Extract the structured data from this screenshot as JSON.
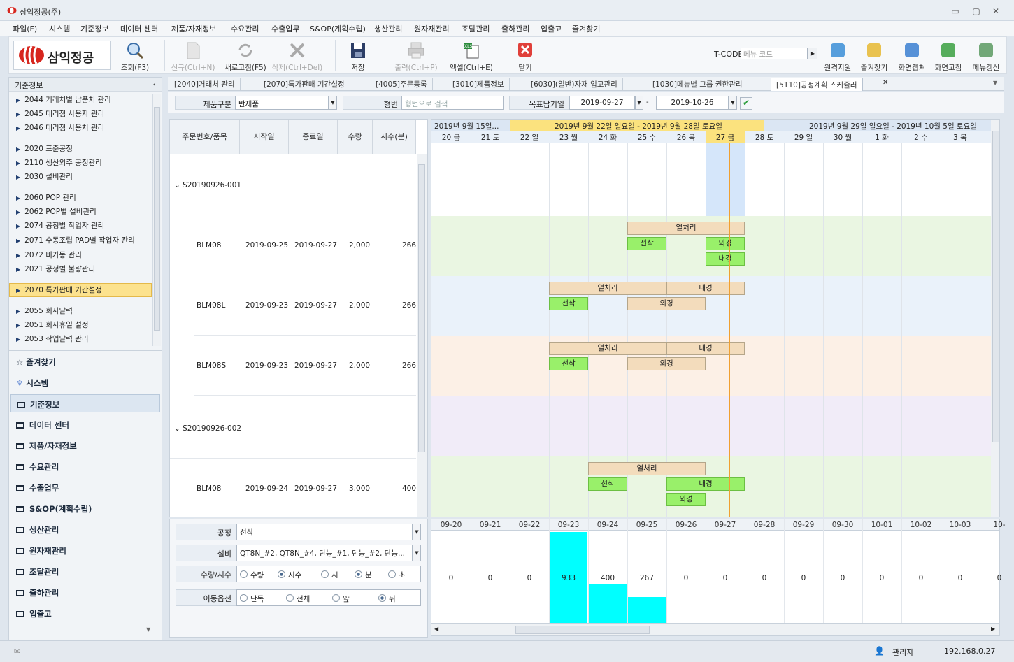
{
  "window": {
    "title": "삼익정공(주)"
  },
  "menu": [
    "파일(F)",
    "시스템",
    "기준정보",
    "데이터 센터",
    "제품/자재정보",
    "수요관리",
    "수출업무",
    "S&OP(계획수립)",
    "생산관리",
    "원자재관리",
    "조달관리",
    "출하관리",
    "입출고",
    "즐겨찾기"
  ],
  "toolbar": {
    "brand": "삼익정공",
    "buttons": [
      {
        "label": "조회(F3)",
        "icon": "search-icon",
        "enabled": true
      },
      {
        "label": "신규(Ctrl+N)",
        "icon": "new-doc-icon",
        "enabled": false
      },
      {
        "label": "새로고침(F5)",
        "icon": "refresh-icon",
        "enabled": true
      },
      {
        "label": "삭제(Ctrl+Del)",
        "icon": "delete-icon",
        "enabled": false
      },
      {
        "label": "저장",
        "icon": "save-icon",
        "enabled": true
      },
      {
        "label": "출력(Ctrl+P)",
        "icon": "print-icon",
        "enabled": false
      },
      {
        "label": "엑셀(Ctrl+E)",
        "icon": "excel-icon",
        "enabled": true
      },
      {
        "label": "닫기",
        "icon": "close-icon",
        "enabled": true
      }
    ],
    "tcode_label": "T-CODE",
    "tcode_placeholder": "메뉴 코드",
    "right_buttons": [
      "원격지원",
      "즐겨찾기",
      "화면캡쳐",
      "화면고침",
      "메뉴갱신"
    ]
  },
  "sidebar": {
    "header": "기준정보",
    "items": [
      "2044 거래처별 납품처 관리",
      "2045 대리점 사용자 관리",
      "2046 대리점 사용처 관리",
      "2020 표준공정",
      "2110 생산외주 공정관리",
      "2030 설비관리",
      "2060 POP 관리",
      "2062 POP별 설비관리",
      "2074 공정별 작업자 관리",
      "2071 수동조립 PAD별 작업자 관리",
      "2072 비가동 관리",
      "2021 공정별 불량관리",
      "2070 특가판매 기간설정",
      "2055 회사달력",
      "2051 회사휴일 설정",
      "2053 작업달력 관리"
    ],
    "selected": "2070 특가판매 기간설정",
    "favorites": "즐겨찾기",
    "system": "시스템",
    "groups": [
      "기준정보",
      "데이터 센터",
      "제품/자재정보",
      "수요관리",
      "수출업무",
      "S&OP(계획수립)",
      "생산관리",
      "원자재관리",
      "조달관리",
      "출하관리",
      "입출고"
    ]
  },
  "tabs": [
    "[2040]거래처 관리",
    "[2070]특가판매 기간설정",
    "[4005]주문등록",
    "[3010]제품정보",
    "[6030](일반)자재 입고관리",
    "[1030]메뉴별 그룹 권한관리",
    "[5110]공정계획 스케쥴러"
  ],
  "filter": {
    "product_type_label": "제품구분",
    "product_type_value": "반제품",
    "model_label": "형번",
    "model_placeholder": "형번으로 검색",
    "target_label": "목표납기일",
    "date_from": "2019-09-27",
    "date_sep": "-",
    "date_to": "2019-10-26"
  },
  "grid": {
    "headers": [
      "주문번호/품목",
      "시작일",
      "종료일",
      "수량",
      "시수(분)"
    ],
    "groups": [
      {
        "order": "S20190926-001",
        "rows": [
          {
            "item": "BLM08",
            "start": "2019-09-25",
            "end": "2019-09-27",
            "qty": "2,000",
            "min": "266"
          },
          {
            "item": "BLM08L",
            "start": "2019-09-23",
            "end": "2019-09-27",
            "qty": "2,000",
            "min": "266"
          },
          {
            "item": "BLM08S",
            "start": "2019-09-23",
            "end": "2019-09-27",
            "qty": "2,000",
            "min": "266"
          }
        ]
      },
      {
        "order": "S20190926-002",
        "rows": [
          {
            "item": "BLM08",
            "start": "2019-09-24",
            "end": "2019-09-27",
            "qty": "3,000",
            "min": "400"
          }
        ]
      }
    ]
  },
  "gantt": {
    "weeks": [
      "2019년 9월 15일...",
      "2019년 9월 22일 일요일 - 2019년 9월 28일 토요일",
      "2019년 9월 29일 일요일 - 2019년 10월 5일 토요일"
    ],
    "days": [
      "20 금",
      "21 토",
      "22 일",
      "23 월",
      "24 화",
      "25 수",
      "26 목",
      "27 금",
      "28 토",
      "29 일",
      "30 월",
      "1 화",
      "2 수",
      "3 목"
    ],
    "bands": [
      "#ffffff",
      "#eaf6e2",
      "#eaf2fa",
      "#fcf0e6",
      "#f1ecf8",
      "#eaf6e2"
    ],
    "tasks": [
      {
        "label": "열처리",
        "band": 1,
        "line": 0,
        "start": 5,
        "span": 3,
        "green": false
      },
      {
        "label": "선삭",
        "band": 1,
        "line": 1,
        "start": 5,
        "span": 1,
        "green": true
      },
      {
        "label": "외경",
        "band": 1,
        "line": 1,
        "start": 7,
        "span": 1,
        "green": true
      },
      {
        "label": "내경",
        "band": 1,
        "line": 2,
        "start": 7,
        "span": 1,
        "green": true
      },
      {
        "label": "열처리",
        "band": 2,
        "line": 0,
        "start": 3,
        "span": 3,
        "green": false
      },
      {
        "label": "내경",
        "band": 2,
        "line": 0,
        "start": 6,
        "span": 2,
        "green": false
      },
      {
        "label": "선삭",
        "band": 2,
        "line": 1,
        "start": 3,
        "span": 1,
        "green": true
      },
      {
        "label": "외경",
        "band": 2,
        "line": 1,
        "start": 5,
        "span": 2,
        "green": false
      },
      {
        "label": "열처리",
        "band": 3,
        "line": 0,
        "start": 3,
        "span": 3,
        "green": false
      },
      {
        "label": "내경",
        "band": 3,
        "line": 0,
        "start": 6,
        "span": 2,
        "green": false
      },
      {
        "label": "선삭",
        "band": 3,
        "line": 1,
        "start": 3,
        "span": 1,
        "green": true
      },
      {
        "label": "외경",
        "band": 3,
        "line": 1,
        "start": 5,
        "span": 2,
        "green": false
      },
      {
        "label": "열처리",
        "band": 5,
        "line": 0,
        "start": 4,
        "span": 3,
        "green": false
      },
      {
        "label": "선삭",
        "band": 5,
        "line": 1,
        "start": 4,
        "span": 1,
        "green": true
      },
      {
        "label": "내경",
        "band": 5,
        "line": 1,
        "start": 6,
        "span": 2,
        "green": true
      },
      {
        "label": "외경",
        "band": 5,
        "line": 2,
        "start": 6,
        "span": 1,
        "green": true
      }
    ]
  },
  "props": {
    "process_label": "공정",
    "process_value": "선삭",
    "equip_label": "설비",
    "equip_value": "QT8N_#2, QT8N_#4, 단능_#1, 단능_#2, 단능...",
    "qty_label": "수량/시수",
    "qty_opts": [
      "수량",
      "시수"
    ],
    "time_opts": [
      "시",
      "분",
      "초"
    ],
    "move_label": "이동옵션",
    "move_opts": [
      "단독",
      "전체",
      "앞",
      "뒤"
    ]
  },
  "load": {
    "dates": [
      "09-20",
      "09-21",
      "09-22",
      "09-23",
      "09-24",
      "09-25",
      "09-26",
      "09-27",
      "09-28",
      "09-29",
      "09-30",
      "10-01",
      "10-02",
      "10-03",
      "10-"
    ],
    "values": [
      "0",
      "0",
      "0",
      "933",
      "400",
      "267",
      "0",
      "0",
      "0",
      "0",
      "0",
      "0",
      "0",
      "0",
      "0"
    ],
    "max": 933
  },
  "status": {
    "user": "관리자",
    "ip": "192.168.0.27"
  }
}
